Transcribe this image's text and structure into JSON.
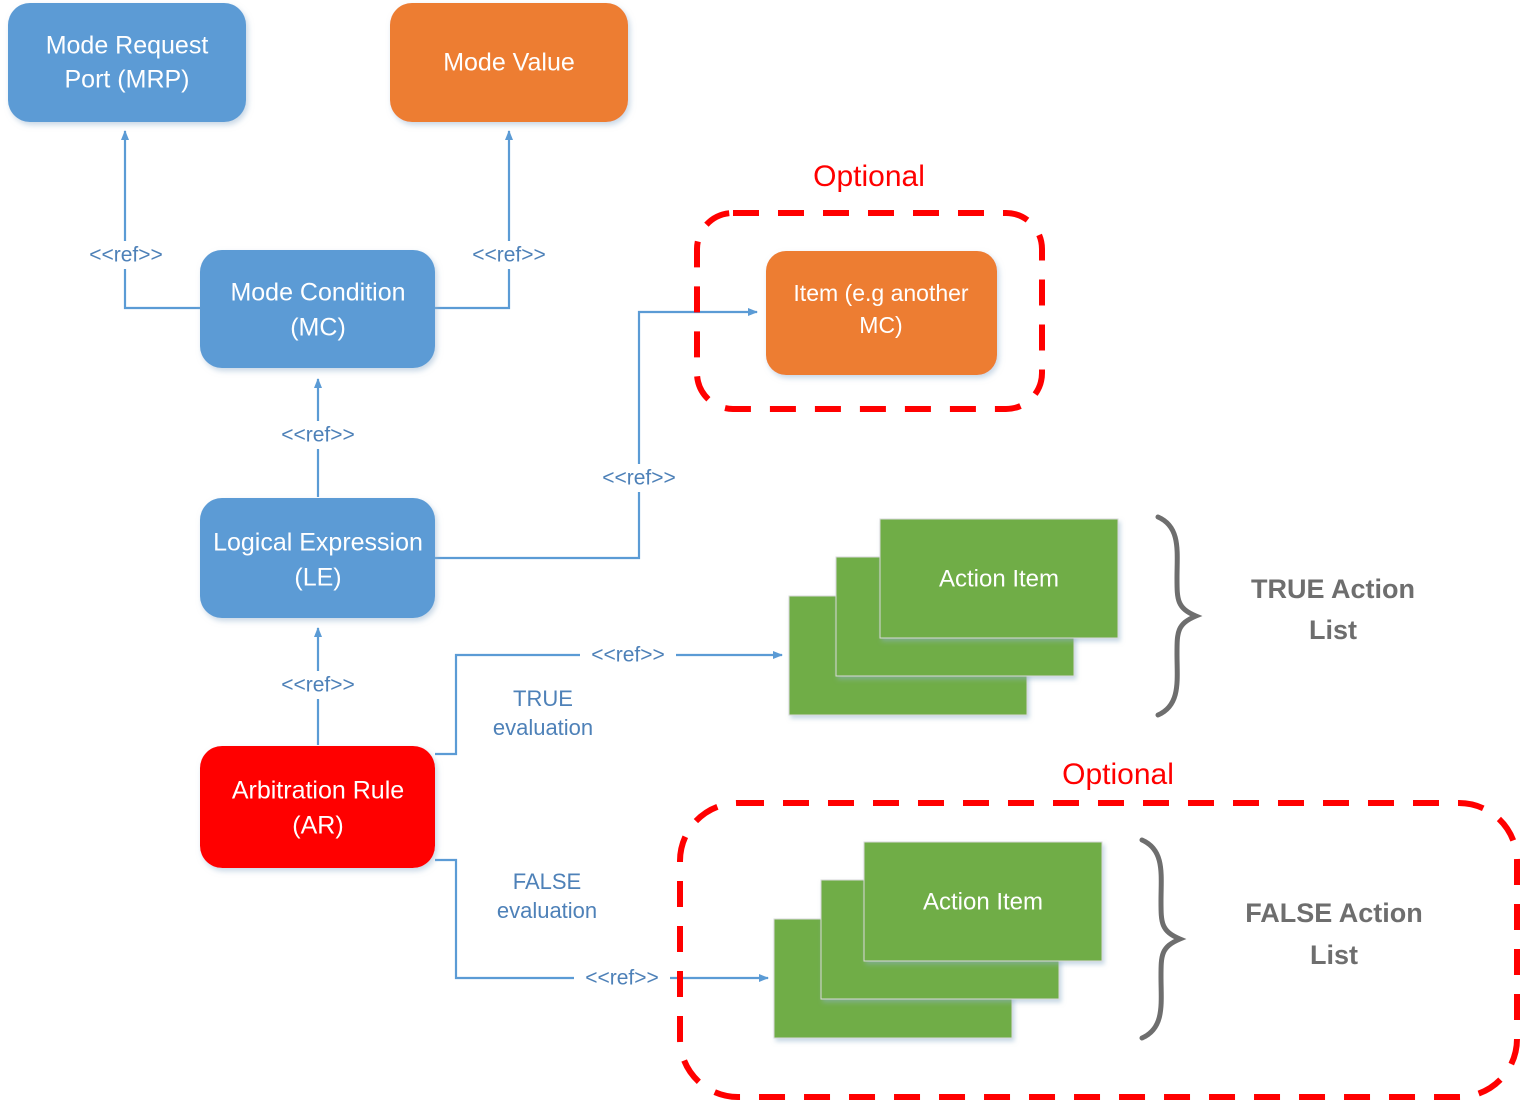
{
  "diagram": {
    "title": "Arbitration Rule structure diagram",
    "colors": {
      "blue": "#5B9BD5",
      "orange": "#ED7D31",
      "red": "#FF0000",
      "green": "#70AD47",
      "connector_blue": "#5B9BD5",
      "ref_text_blue": "#4E81B8",
      "gray_label": "#6E6E6E",
      "white": "#FFFFFF"
    },
    "nodes": {
      "mode_request_port": {
        "line1": "Mode Request",
        "line2": "Port (MRP)",
        "color": "#5B9BD5"
      },
      "mode_value": {
        "line1": "Mode Value",
        "line2": "",
        "color": "#ED7D31"
      },
      "mode_condition": {
        "line1": "Mode Condition",
        "line2": "(MC)",
        "color": "#5B9BD5"
      },
      "logical_expression": {
        "line1": "Logical Expression",
        "line2": "(LE)",
        "color": "#5B9BD5"
      },
      "arbitration_rule": {
        "line1": "Arbitration Rule",
        "line2": "(AR)",
        "color": "#FF0000"
      },
      "item_another_mc": {
        "line1": "Item (e.g another",
        "line2": "MC)",
        "color": "#ED7D31"
      },
      "true_action_item": {
        "label": "Action Item",
        "color": "#70AD47"
      },
      "false_action_item": {
        "label": "Action Item",
        "color": "#70AD47"
      }
    },
    "edge_labels": {
      "mc_to_mrp": "<<ref>>",
      "mc_to_mode_value": "<<ref>>",
      "le_to_mc": "<<ref>>",
      "le_to_item": "<<ref>>",
      "ar_to_le": "<<ref>>",
      "ar_true_ref": "<<ref>>",
      "ar_false_ref": "<<ref>>"
    },
    "evaluation_labels": {
      "true_line1": "TRUE",
      "true_line2": "evaluation",
      "false_line1": "FALSE",
      "false_line2": "evaluation"
    },
    "group_labels": {
      "optional_top": "Optional",
      "optional_bottom": "Optional",
      "true_action_list_line1": "TRUE Action",
      "true_action_list_line2": "List",
      "false_action_list_line1": "FALSE Action",
      "false_action_list_line2": "List"
    }
  }
}
